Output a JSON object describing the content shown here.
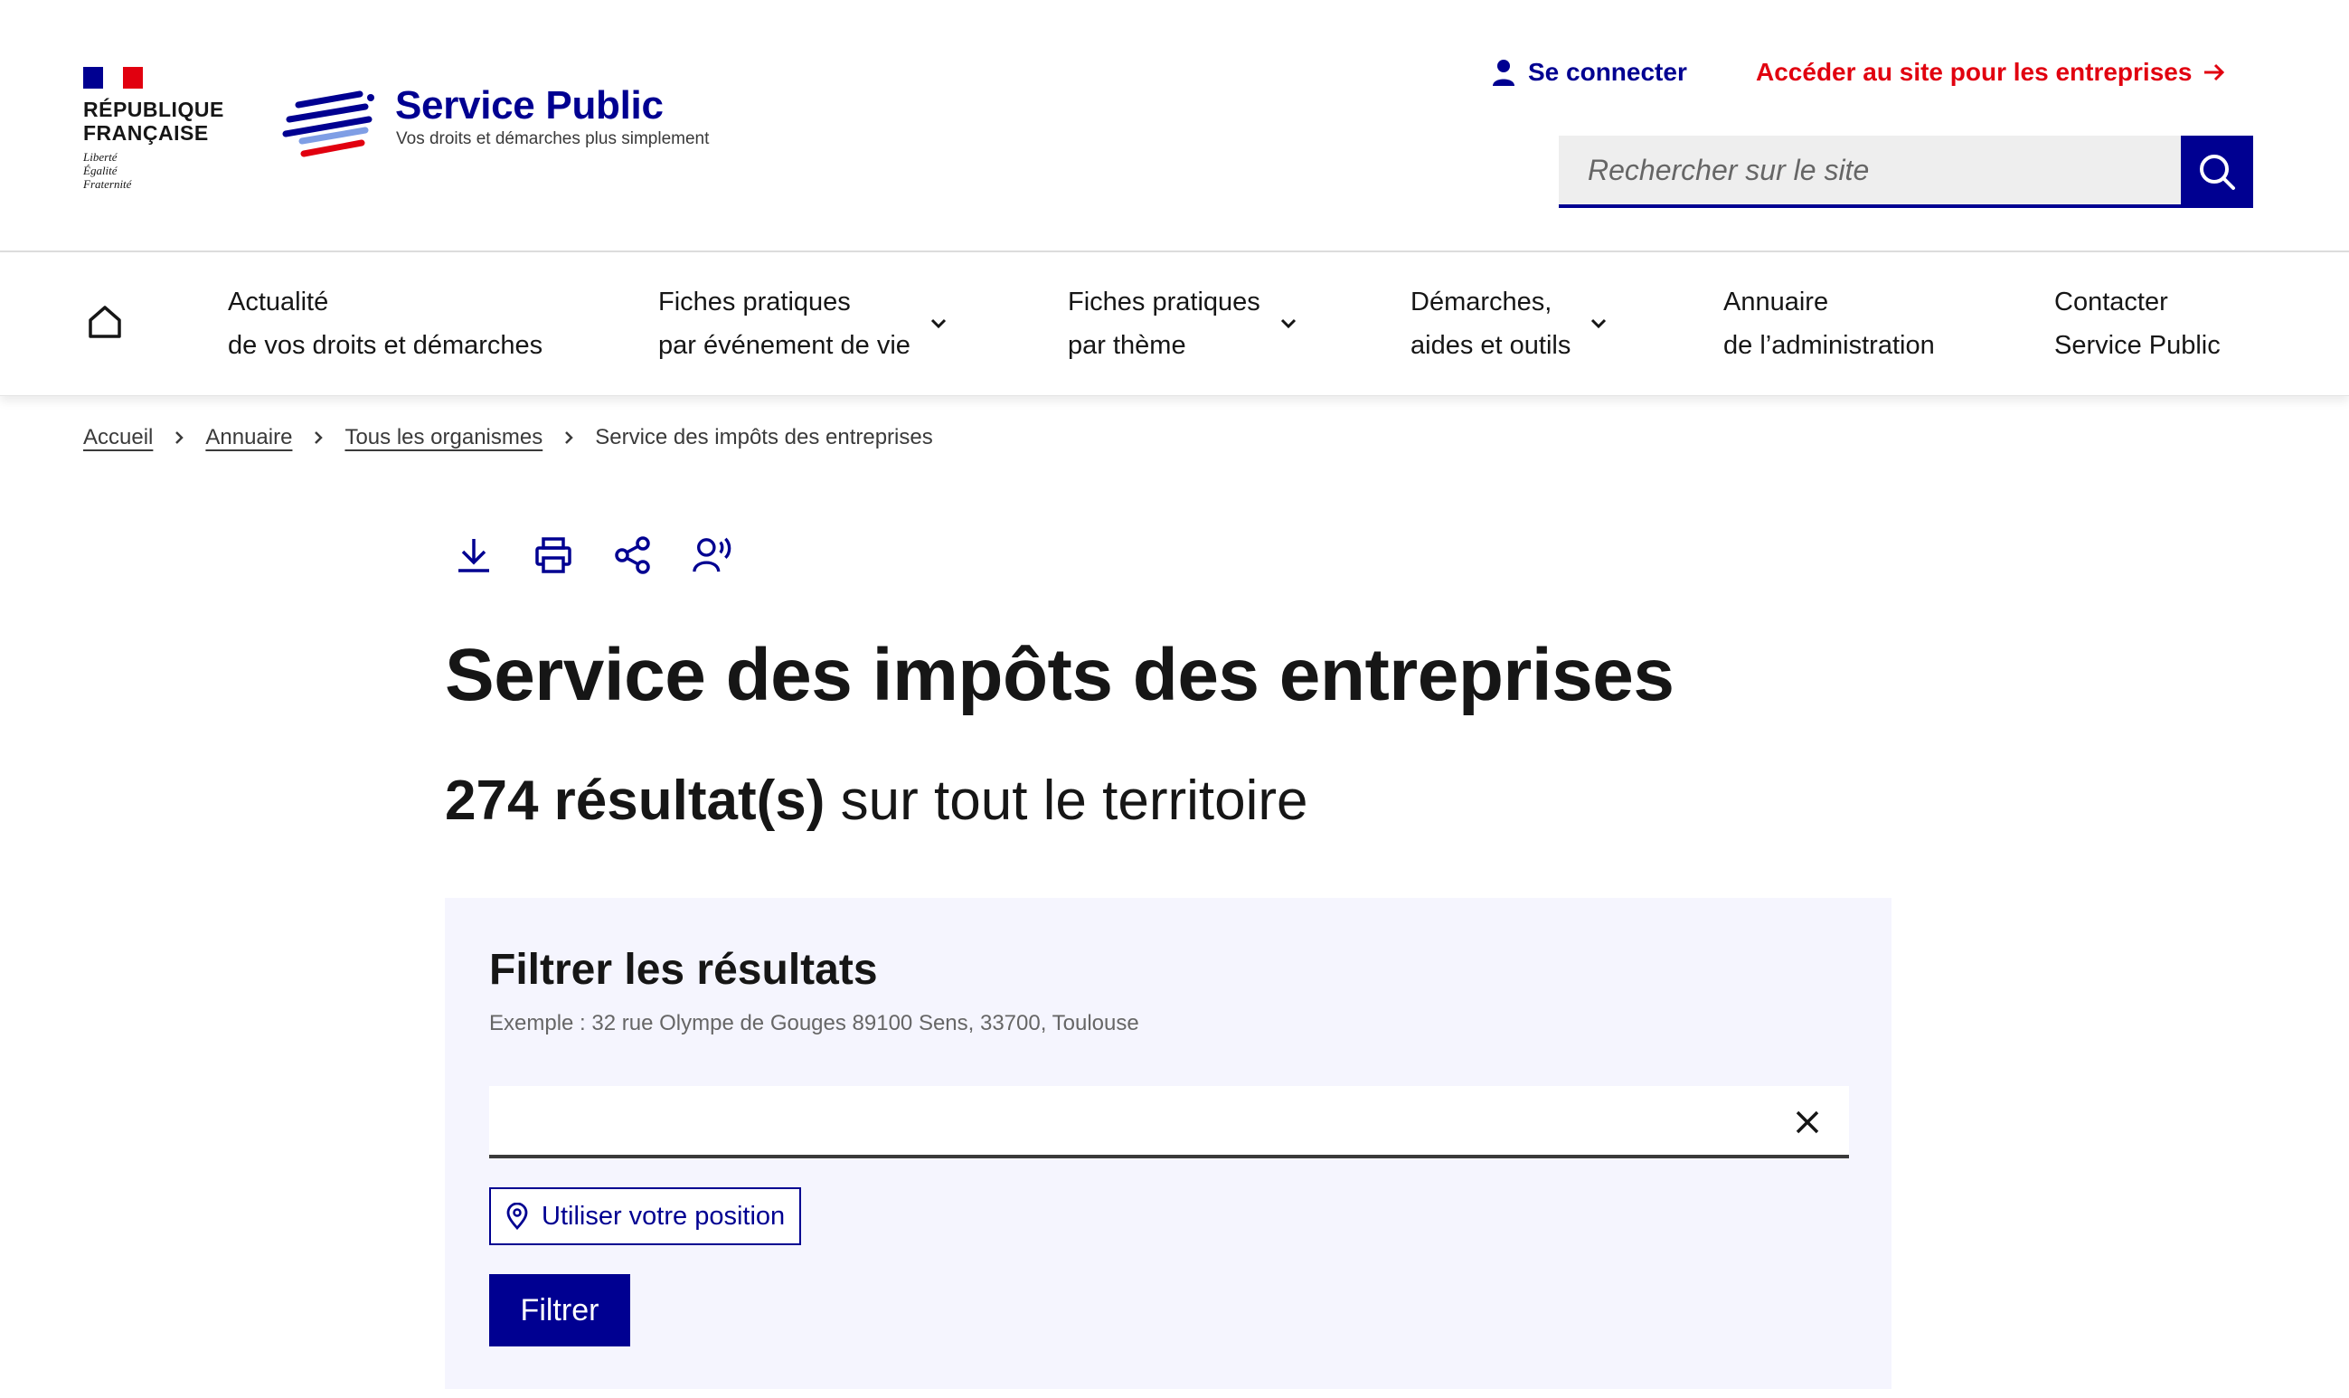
{
  "header": {
    "republic": [
      "RÉPUBLIQUE",
      "FRANÇAISE"
    ],
    "motto": [
      "Liberté",
      "Égalité",
      "Fraternité"
    ],
    "site_title": "Service Public",
    "site_tagline": "Vos droits et démarches plus simplement",
    "login_label": "Se connecter",
    "pro_link_label": "Accéder au site pour les entreprises",
    "search_placeholder": "Rechercher sur le site",
    "colors": {
      "primary": "#000091",
      "accent_red": "#e1000f"
    }
  },
  "nav": {
    "home_icon": "home-icon",
    "items": [
      {
        "line1": "Actualité",
        "line2": "de vos droits et démarches",
        "has_dropdown": false
      },
      {
        "line1": "Fiches pratiques",
        "line2": "par événement de vie",
        "has_dropdown": true
      },
      {
        "line1": "Fiches pratiques",
        "line2": "par thème",
        "has_dropdown": true
      },
      {
        "line1": "Démarches,",
        "line2": "aides et outils",
        "has_dropdown": true
      },
      {
        "line1": "Annuaire",
        "line2": "de l’administration",
        "has_dropdown": false
      },
      {
        "line1": "Contacter",
        "line2": "Service Public",
        "has_dropdown": false
      }
    ]
  },
  "breadcrumb": {
    "items": [
      "Accueil",
      "Annuaire",
      "Tous les organismes"
    ],
    "current": "Service des impôts des entreprises"
  },
  "tools": [
    "download-icon",
    "print-icon",
    "share-icon",
    "listen-icon"
  ],
  "main": {
    "title": "Service des impôts des entreprises",
    "result_count": "274 résultat(s)",
    "result_suffix": "sur tout le territoire"
  },
  "filter": {
    "title": "Filtrer les résultats",
    "hint": "Exemple : 32 rue Olympe de Gouges 89100 Sens, 33700, Toulouse",
    "input_value": "",
    "geo_button_label": "Utiliser votre position",
    "submit_label": "Filtrer"
  }
}
